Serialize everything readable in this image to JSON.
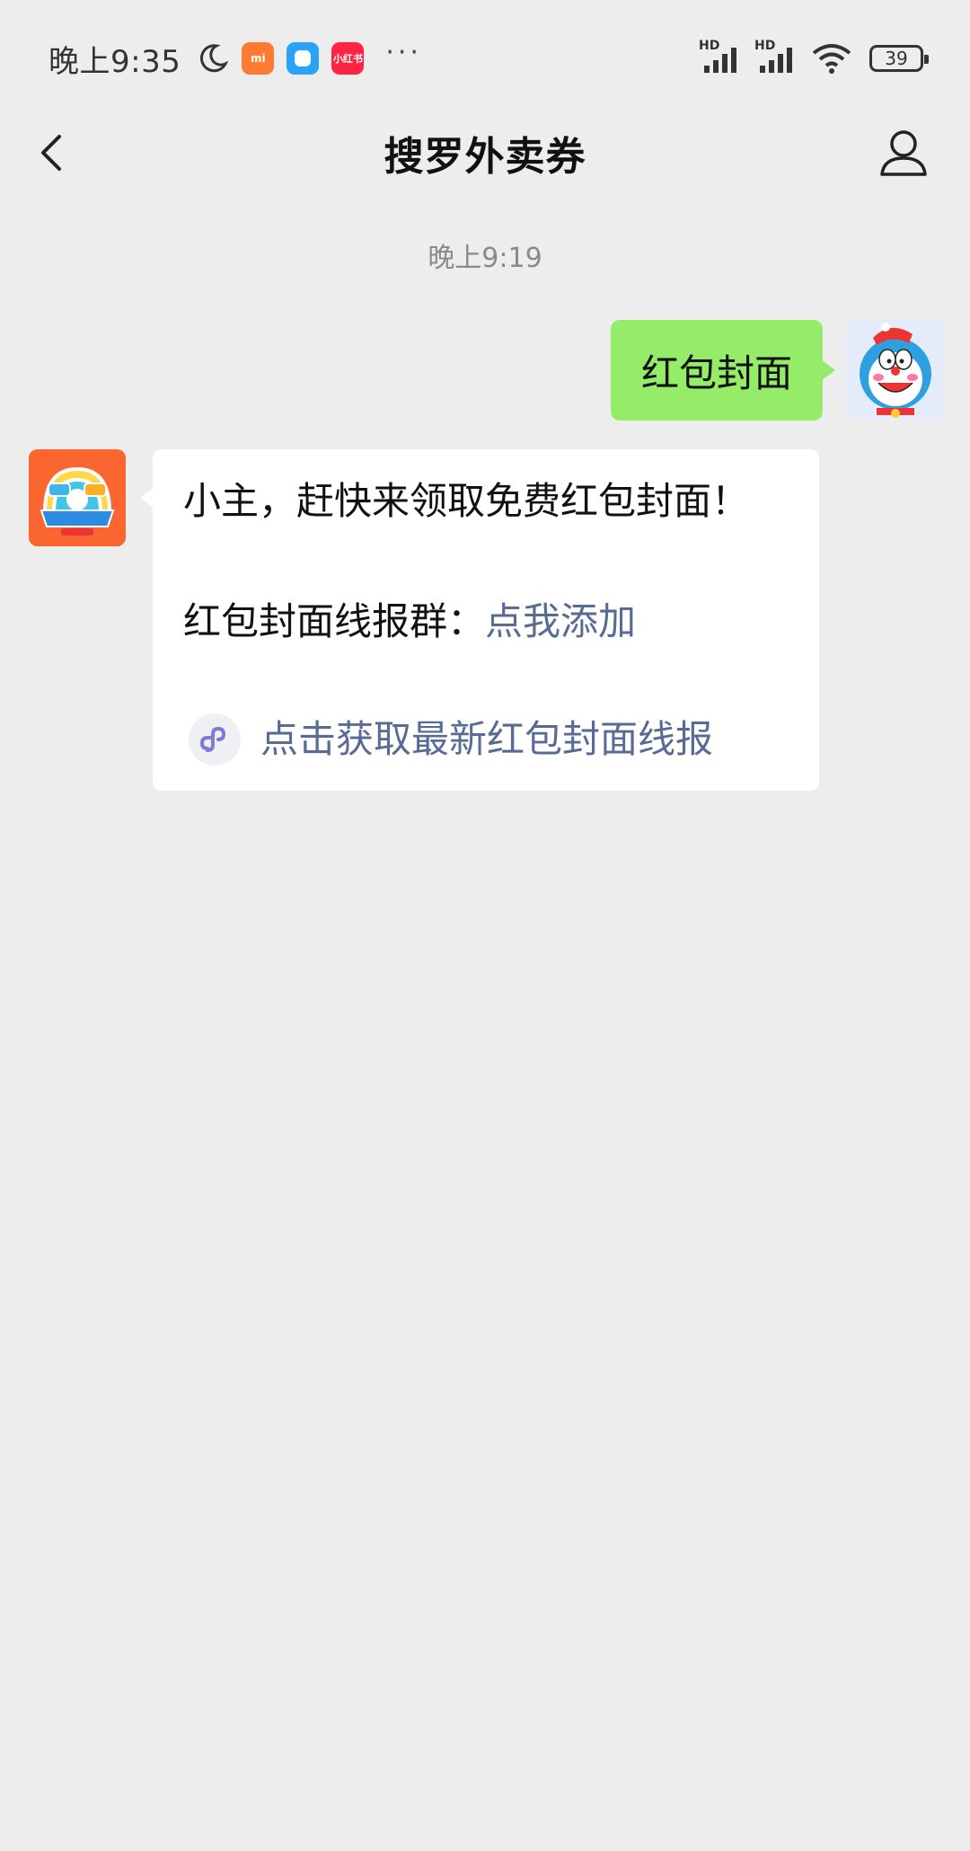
{
  "status_bar": {
    "time": "晚上9:35",
    "notif_icons": [
      "moon-icon",
      "mi-store-icon",
      "message-app-icon",
      "xiaohongshu-icon"
    ],
    "xiaohongshu_label": "小红书",
    "mi_label": "mi",
    "more": "···",
    "signal_1_label": "HD",
    "signal_2_label": "HD",
    "battery": "39"
  },
  "nav": {
    "title": "搜罗外卖券"
  },
  "chat": {
    "timestamp": "晚上9:19",
    "outgoing": {
      "text": "红包封面"
    },
    "incoming": {
      "line1": "小主，赶快来领取免费红包封面！",
      "line2_prefix": "红包封面线报群：",
      "line2_link": "点我添加",
      "mini_program_text": "点击获取最新红包封面线报"
    }
  },
  "colors": {
    "background": "#ededed",
    "bubble_outgoing": "#95ec69",
    "bubble_incoming": "#ffffff",
    "link": "#576b95",
    "bot_avatar": "#fb6630"
  }
}
